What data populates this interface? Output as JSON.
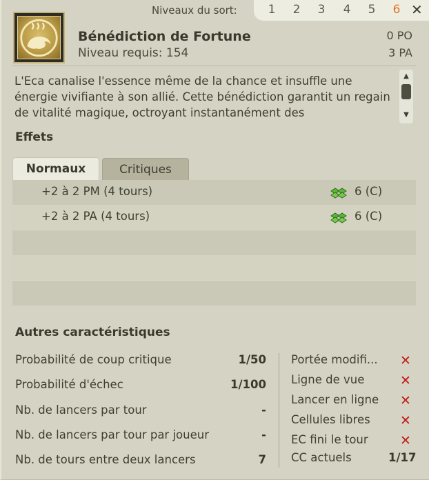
{
  "header": {
    "levels_label": "Niveaux du sort:",
    "levels": [
      "1",
      "2",
      "3",
      "4",
      "5",
      "6"
    ],
    "active_level": "6",
    "close_symbol": "✕"
  },
  "spell": {
    "name": "Bénédiction de Fortune",
    "required_level": "Niveau requis: 154",
    "po": "0 PO",
    "pa": "3 PA",
    "icon": "fortune-blessing-icon",
    "description": "L'Eca canalise l'essence même de la chance et insuffle une énergie vivifiante à son allié. Cette bénédiction garantit un regain de vitalité magique, octroyant instantanément des"
  },
  "effects": {
    "title": "Effets",
    "tab_normal": "Normaux",
    "tab_critical": "Critiques",
    "rows": [
      {
        "text": "+2 à 2 PM (4 tours)",
        "value": "6 (C)"
      },
      {
        "text": "+2 à 2 PA (4 tours)",
        "value": "6 (C)"
      }
    ]
  },
  "other": {
    "title": "Autres caractéristiques",
    "stats": [
      {
        "label": "Probabilité de coup critique",
        "value": "1/50"
      },
      {
        "label": "Probabilité d'échec",
        "value": "1/100"
      },
      {
        "label": "Nb. de lancers par tour",
        "value": "-"
      },
      {
        "label": "Nb. de lancers par tour par joueur",
        "value": "-"
      },
      {
        "label": "Nb. de tours entre deux lancers",
        "value": "7"
      }
    ],
    "flags": [
      {
        "label": "Portée modifi...",
        "value": "✕"
      },
      {
        "label": "Ligne de vue",
        "value": "✕"
      },
      {
        "label": "Lancer en ligne",
        "value": "✕"
      },
      {
        "label": "Cellules libres",
        "value": "✕"
      },
      {
        "label": "EC fini le tour",
        "value": "✕"
      },
      {
        "label": "CC actuels",
        "value": "1/17"
      }
    ]
  },
  "colors": {
    "active_level": "#e0751c",
    "cross": "#c21a1a",
    "panel_bg": "#d5d4c4"
  }
}
